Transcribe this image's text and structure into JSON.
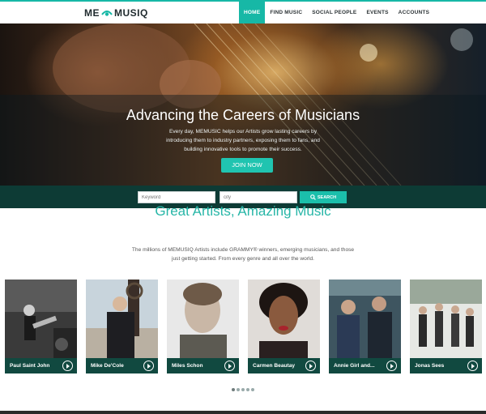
{
  "brand": {
    "part1": "ME",
    "part2": "MUSIQ",
    "accent": "#17b8a6"
  },
  "nav": {
    "items": [
      {
        "label": "HOME"
      },
      {
        "label": "FIND MUSIC"
      },
      {
        "label": "SOCIAL PEOPLE"
      },
      {
        "label": "EVENTS"
      },
      {
        "label": "ACCOUNTS"
      }
    ]
  },
  "hero": {
    "title": "Advancing the Careers of Musicians",
    "subtitle": "Every day, MEMUSIC helps our Artists grow lasting careers by introducing them to industry partners, exposing them to fans, and building innovative tools to promote their success.",
    "cta": "JOIN NOW"
  },
  "search": {
    "keyword_placeholder": "Keyword",
    "city_placeholder": "city",
    "button_label": "SEARCH",
    "button_icon": "search-icon"
  },
  "artists_section": {
    "title": "Great Artists, Amazing Music",
    "description": "The millions of MEMUSIQ Artists include GRAMMY® winners, emerging musicians, and those just getting started. From every genre and all over the world."
  },
  "artists": [
    {
      "name": "Paul Saint John"
    },
    {
      "name": "Mike De'Cole"
    },
    {
      "name": "Miles Schon"
    },
    {
      "name": "Carmen Beautay"
    },
    {
      "name": "Annie Girl and..."
    },
    {
      "name": "Jonas Sees"
    }
  ],
  "carousel": {
    "pages": 5,
    "active": 0
  }
}
